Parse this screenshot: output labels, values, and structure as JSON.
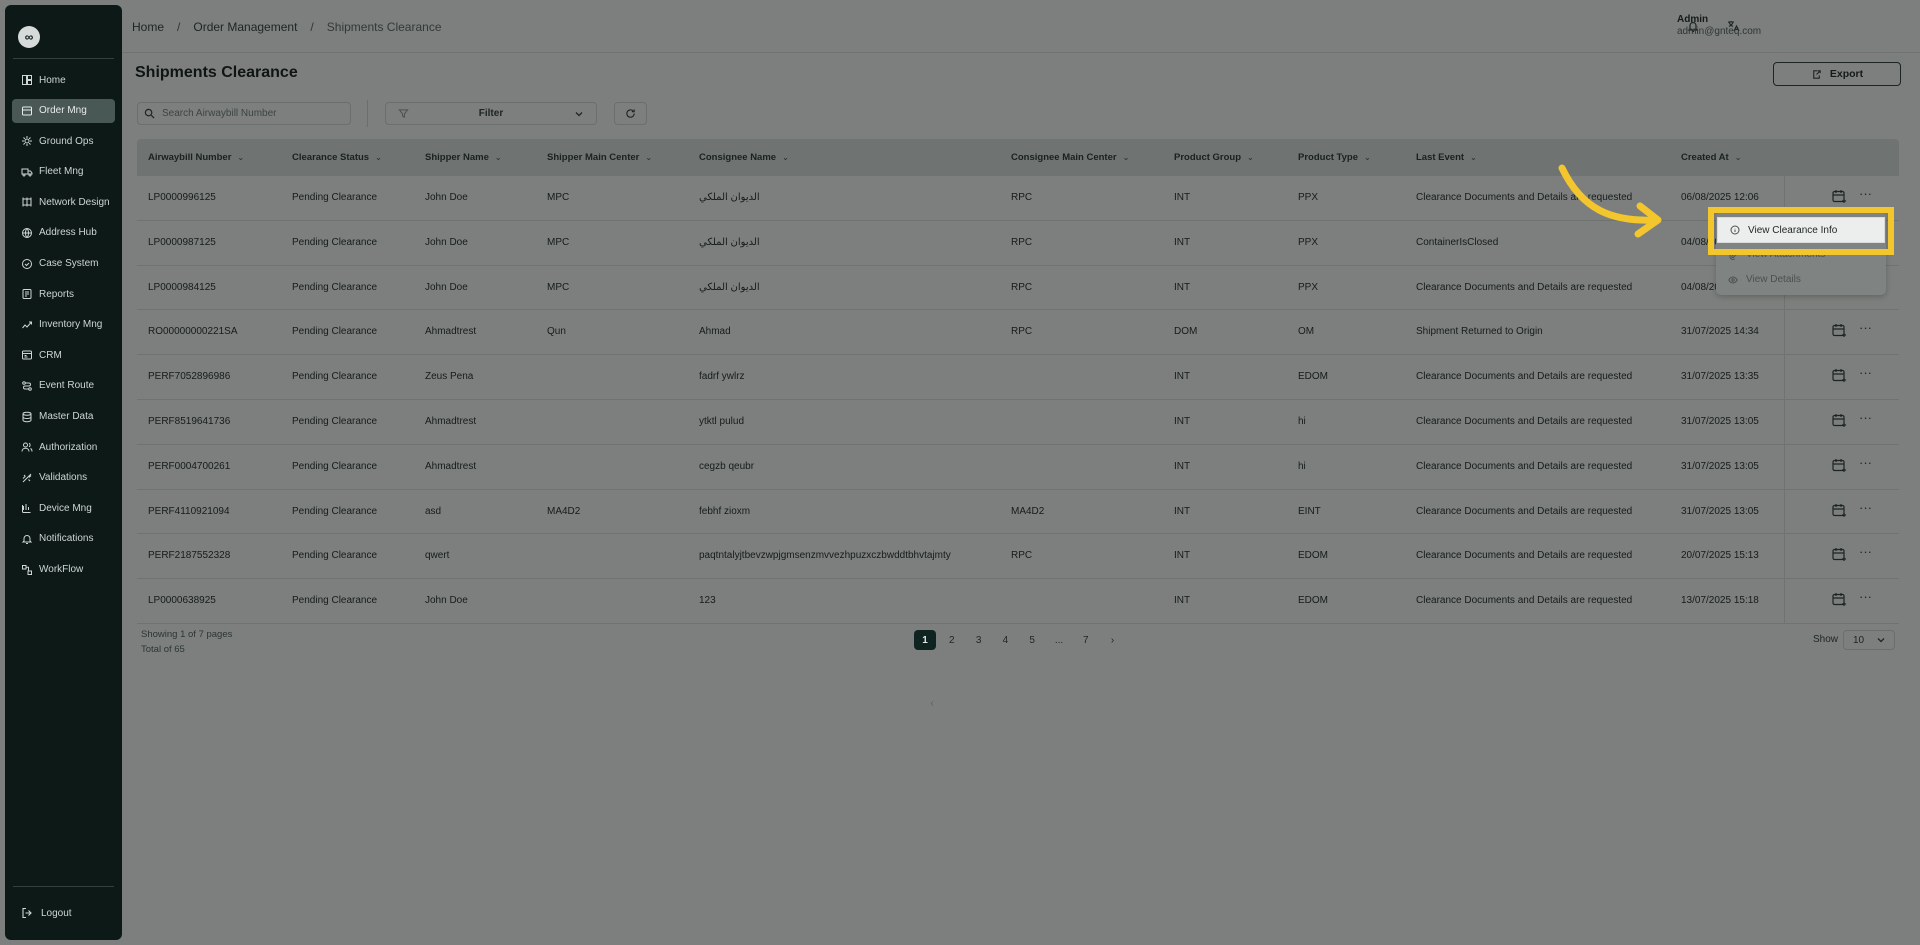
{
  "sidebar": {
    "logo": "∞",
    "items": [
      {
        "label": "Home",
        "icon": "home-icon"
      },
      {
        "label": "Order Mng",
        "icon": "order-icon",
        "active": true
      },
      {
        "label": "Ground Ops",
        "icon": "ground-ops-icon"
      },
      {
        "label": "Fleet Mng",
        "icon": "truck-icon"
      },
      {
        "label": "Network Design",
        "icon": "network-icon"
      },
      {
        "label": "Address Hub",
        "icon": "address-icon"
      },
      {
        "label": "Case System",
        "icon": "case-icon"
      },
      {
        "label": "Reports",
        "icon": "report-icon"
      },
      {
        "label": "Inventory Mng",
        "icon": "inventory-icon"
      },
      {
        "label": "CRM",
        "icon": "crm-icon"
      },
      {
        "label": "Event Route",
        "icon": "route-icon"
      },
      {
        "label": "Master Data",
        "icon": "database-icon"
      },
      {
        "label": "Authorization",
        "icon": "users-icon"
      },
      {
        "label": "Validations",
        "icon": "validation-icon"
      },
      {
        "label": "Device Mng",
        "icon": "device-icon"
      },
      {
        "label": "Notifications",
        "icon": "bell-icon"
      },
      {
        "label": "WorkFlow",
        "icon": "workflow-icon"
      }
    ],
    "logout_label": "Logout"
  },
  "topbar": {
    "breadcrumb": {
      "home": "Home",
      "section": "Order Management",
      "current": "Shipments Clearance",
      "sep": "/"
    },
    "user": {
      "name": "Admin",
      "email": "admin@gnteq.com"
    }
  },
  "page": {
    "title": "Shipments Clearance",
    "export_label": "Export",
    "search_placeholder": "Search Airwaybill Number",
    "filter_label": "Filter"
  },
  "table": {
    "columns": [
      "Airwaybill Number",
      "Clearance Status",
      "Shipper Name",
      "Shipper Main Center",
      "Consignee Name",
      "Consignee Main Center",
      "Product Group",
      "Product Type",
      "Last Event",
      "Created At"
    ],
    "rows": [
      [
        "LP0000996125",
        "Pending Clearance",
        "John Doe",
        "MPC",
        "الديوان الملكي",
        "RPC",
        "INT",
        "PPX",
        "Clearance Documents and Details are requested",
        "06/08/2025 12:06"
      ],
      [
        "LP0000987125",
        "Pending Clearance",
        "John Doe",
        "MPC",
        "الديوان الملكي",
        "RPC",
        "INT",
        "PPX",
        "ContainerIsClosed",
        "04/08/2025 15:20"
      ],
      [
        "LP0000984125",
        "Pending Clearance",
        "John Doe",
        "MPC",
        "الديوان الملكي",
        "RPC",
        "INT",
        "PPX",
        "Clearance Documents and Details are requested",
        "04/08/2025 15:02"
      ],
      [
        "RO00000000221SA",
        "Pending Clearance",
        "Ahmadtrest",
        "Qun",
        "Ahmad",
        "RPC",
        "DOM",
        "OM",
        "Shipment Returned to Origin",
        "31/07/2025 14:34"
      ],
      [
        "PERF7052896986",
        "Pending Clearance",
        "Zeus Pena",
        "",
        "fadrf ywlrz",
        "",
        "INT",
        "EDOM",
        "Clearance Documents and Details are requested",
        "31/07/2025 13:35"
      ],
      [
        "PERF8519641736",
        "Pending Clearance",
        "Ahmadtrest",
        "",
        "ytktl pulud",
        "",
        "INT",
        "hi",
        "Clearance Documents and Details are requested",
        "31/07/2025 13:05"
      ],
      [
        "PERF0004700261",
        "Pending Clearance",
        "Ahmadtrest",
        "",
        "cegzb qeubr",
        "",
        "INT",
        "hi",
        "Clearance Documents and Details are requested",
        "31/07/2025 13:05"
      ],
      [
        "PERF4110921094",
        "Pending Clearance",
        "asd",
        "MA4D2",
        "febhf zioxm",
        "MA4D2",
        "INT",
        "EINT",
        "Clearance Documents and Details are requested",
        "31/07/2025 13:05"
      ],
      [
        "PERF2187552328",
        "Pending Clearance",
        "qwert",
        "",
        "paqtntalyjtbevzwpjgmsenzmvvezhpuzxczbwddtbhvtajmty",
        "RPC",
        "INT",
        "EDOM",
        "Clearance Documents and Details are requested",
        "20/07/2025 15:13"
      ],
      [
        "LP0000638925",
        "Pending Clearance",
        "John Doe",
        "",
        "123",
        "",
        "INT",
        "EDOM",
        "Clearance Documents and Details are requested",
        "13/07/2025 15:18"
      ]
    ]
  },
  "footer": {
    "showing": "Showing 1 of 7 pages",
    "total": "Total of 65",
    "pages": [
      "1",
      "2",
      "3",
      "4",
      "5",
      "...",
      "7"
    ],
    "show_label": "Show",
    "page_size": "10"
  },
  "context_menu": {
    "items": [
      "View Clearance Info",
      "View Attachments",
      "View Details"
    ]
  },
  "colors": {
    "highlight": "#f2c62c",
    "sidebar": "#0c1917",
    "active_page": "#0f2420"
  }
}
